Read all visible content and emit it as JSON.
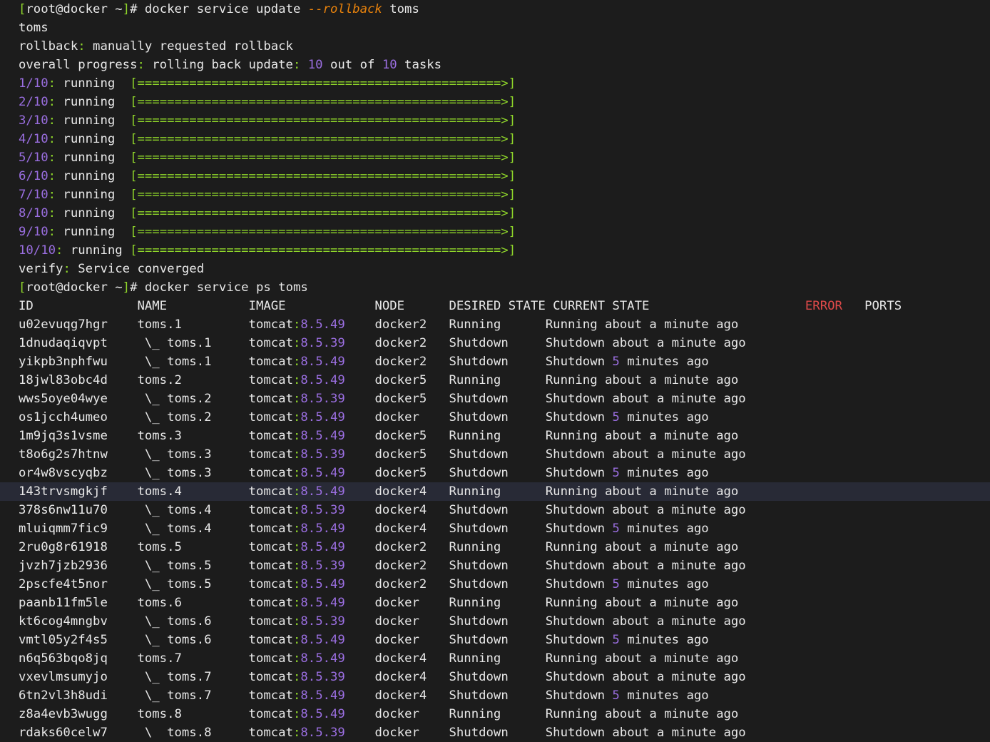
{
  "terminal": {
    "background_color": "#1c1c1c",
    "foreground_color": "#e8e8e8",
    "highlight_color": "#282a36",
    "accent_colors": {
      "green": "#8fd62a",
      "purple": "#9a6ee0",
      "orange": "#e8820c",
      "red": "#e04a4a"
    },
    "prompt": {
      "open_bracket": "[",
      "user_host_path": "root@docker ~",
      "close_bracket": "]",
      "sigil": "# "
    },
    "commands": {
      "first": {
        "program": "docker service update ",
        "flag": "--rollback",
        "argument": " toms"
      },
      "second": {
        "program": "docker service ps toms"
      }
    },
    "update_output": {
      "service_name": "toms",
      "rollback_label": "rollback",
      "rollback_message": " manually requested rollback",
      "overall_label": "overall progress",
      "overall_message_prefix": " rolling back update",
      "overall_count_current": "10",
      "overall_count_mid": " out of ",
      "overall_count_total": "10",
      "overall_count_suffix": " tasks",
      "verify_label": "verify",
      "verify_message": " Service converged",
      "status_word": "running",
      "bar_open": "[",
      "bar_fill": "=================================================>",
      "bar_close": "]",
      "tasks": [
        {
          "index": "1/10",
          "status": "running"
        },
        {
          "index": "2/10",
          "status": "running"
        },
        {
          "index": "3/10",
          "status": "running"
        },
        {
          "index": "4/10",
          "status": "running"
        },
        {
          "index": "5/10",
          "status": "running"
        },
        {
          "index": "6/10",
          "status": "running"
        },
        {
          "index": "7/10",
          "status": "running"
        },
        {
          "index": "8/10",
          "status": "running"
        },
        {
          "index": "9/10",
          "status": "running"
        },
        {
          "index": "10/10",
          "status": "running"
        }
      ]
    },
    "ps_table": {
      "headers": {
        "id": "ID",
        "name": "NAME",
        "image": "IMAGE",
        "node": "NODE",
        "desired_state": "DESIRED STATE",
        "current_state": "CURRENT STATE",
        "error": "ERROR",
        "ports": "PORTS"
      },
      "image_repo": "tomcat",
      "rows": [
        {
          "id": "u02evuqg7hgr",
          "name": "toms.1",
          "indent": false,
          "tag": "8.5.49",
          "node": "docker2",
          "desired": "Running",
          "current_state": "Running",
          "current_time": "about a minute ago",
          "time_num": "",
          "error": "",
          "ports": "",
          "highlight": false
        },
        {
          "id": "1dnudaqiqvpt",
          "name": "\\_ toms.1",
          "indent": true,
          "tag": "8.5.39",
          "node": "docker2",
          "desired": "Shutdown",
          "current_state": "Shutdown",
          "current_time": "about a minute ago",
          "time_num": "",
          "error": "",
          "ports": "",
          "highlight": false
        },
        {
          "id": "yikpb3nphfwu",
          "name": "\\_ toms.1",
          "indent": true,
          "tag": "8.5.49",
          "node": "docker2",
          "desired": "Shutdown",
          "current_state": "Shutdown",
          "current_time": "minutes ago",
          "time_num": "5",
          "error": "",
          "ports": "",
          "highlight": false
        },
        {
          "id": "18jwl83obc4d",
          "name": "toms.2",
          "indent": false,
          "tag": "8.5.49",
          "node": "docker5",
          "desired": "Running",
          "current_state": "Running",
          "current_time": "about a minute ago",
          "time_num": "",
          "error": "",
          "ports": "",
          "highlight": false
        },
        {
          "id": "wws5oye04wye",
          "name": "\\_ toms.2",
          "indent": true,
          "tag": "8.5.39",
          "node": "docker5",
          "desired": "Shutdown",
          "current_state": "Shutdown",
          "current_time": "about a minute ago",
          "time_num": "",
          "error": "",
          "ports": "",
          "highlight": false
        },
        {
          "id": "os1jcch4umeo",
          "name": "\\_ toms.2",
          "indent": true,
          "tag": "8.5.49",
          "node": "docker",
          "desired": "Shutdown",
          "current_state": "Shutdown",
          "current_time": "minutes ago",
          "time_num": "5",
          "error": "",
          "ports": "",
          "highlight": false
        },
        {
          "id": "1m9jq3s1vsme",
          "name": "toms.3",
          "indent": false,
          "tag": "8.5.49",
          "node": "docker5",
          "desired": "Running",
          "current_state": "Running",
          "current_time": "about a minute ago",
          "time_num": "",
          "error": "",
          "ports": "",
          "highlight": false
        },
        {
          "id": "t8o6g2s7htnw",
          "name": "\\_ toms.3",
          "indent": true,
          "tag": "8.5.39",
          "node": "docker5",
          "desired": "Shutdown",
          "current_state": "Shutdown",
          "current_time": "about a minute ago",
          "time_num": "",
          "error": "",
          "ports": "",
          "highlight": false
        },
        {
          "id": "or4w8vscyqbz",
          "name": "\\_ toms.3",
          "indent": true,
          "tag": "8.5.49",
          "node": "docker5",
          "desired": "Shutdown",
          "current_state": "Shutdown",
          "current_time": "minutes ago",
          "time_num": "5",
          "error": "",
          "ports": "",
          "highlight": false
        },
        {
          "id": "143trvsmgkjf",
          "name": "toms.4",
          "indent": false,
          "tag": "8.5.49",
          "node": "docker4",
          "desired": "Running",
          "current_state": "Running",
          "current_time": "about a minute ago",
          "time_num": "",
          "error": "",
          "ports": "",
          "highlight": true
        },
        {
          "id": "378s6nw11u70",
          "name": "\\_ toms.4",
          "indent": true,
          "tag": "8.5.39",
          "node": "docker4",
          "desired": "Shutdown",
          "current_state": "Shutdown",
          "current_time": "about a minute ago",
          "time_num": "",
          "error": "",
          "ports": "",
          "highlight": false
        },
        {
          "id": "mluiqmm7fic9",
          "name": "\\_ toms.4",
          "indent": true,
          "tag": "8.5.49",
          "node": "docker4",
          "desired": "Shutdown",
          "current_state": "Shutdown",
          "current_time": "minutes ago",
          "time_num": "5",
          "error": "",
          "ports": "",
          "highlight": false
        },
        {
          "id": "2ru0g8r61918",
          "name": "toms.5",
          "indent": false,
          "tag": "8.5.49",
          "node": "docker2",
          "desired": "Running",
          "current_state": "Running",
          "current_time": "about a minute ago",
          "time_num": "",
          "error": "",
          "ports": "",
          "highlight": false
        },
        {
          "id": "jvzh7jzb2936",
          "name": "\\_ toms.5",
          "indent": true,
          "tag": "8.5.39",
          "node": "docker2",
          "desired": "Shutdown",
          "current_state": "Shutdown",
          "current_time": "about a minute ago",
          "time_num": "",
          "error": "",
          "ports": "",
          "highlight": false
        },
        {
          "id": "2pscfe4t5nor",
          "name": "\\_ toms.5",
          "indent": true,
          "tag": "8.5.49",
          "node": "docker2",
          "desired": "Shutdown",
          "current_state": "Shutdown",
          "current_time": "minutes ago",
          "time_num": "5",
          "error": "",
          "ports": "",
          "highlight": false
        },
        {
          "id": "paanb11fm5le",
          "name": "toms.6",
          "indent": false,
          "tag": "8.5.49",
          "node": "docker",
          "desired": "Running",
          "current_state": "Running",
          "current_time": "about a minute ago",
          "time_num": "",
          "error": "",
          "ports": "",
          "highlight": false
        },
        {
          "id": "kt6cog4mngbv",
          "name": "\\_ toms.6",
          "indent": true,
          "tag": "8.5.39",
          "node": "docker",
          "desired": "Shutdown",
          "current_state": "Shutdown",
          "current_time": "about a minute ago",
          "time_num": "",
          "error": "",
          "ports": "",
          "highlight": false
        },
        {
          "id": "vmtl05y2f4s5",
          "name": "\\_ toms.6",
          "indent": true,
          "tag": "8.5.49",
          "node": "docker",
          "desired": "Shutdown",
          "current_state": "Shutdown",
          "current_time": "minutes ago",
          "time_num": "5",
          "error": "",
          "ports": "",
          "highlight": false
        },
        {
          "id": "n6q563bqo8jq",
          "name": "toms.7",
          "indent": false,
          "tag": "8.5.49",
          "node": "docker4",
          "desired": "Running",
          "current_state": "Running",
          "current_time": "about a minute ago",
          "time_num": "",
          "error": "",
          "ports": "",
          "highlight": false
        },
        {
          "id": "vxevlmsumyjo",
          "name": "\\_ toms.7",
          "indent": true,
          "tag": "8.5.39",
          "node": "docker4",
          "desired": "Shutdown",
          "current_state": "Shutdown",
          "current_time": "about a minute ago",
          "time_num": "",
          "error": "",
          "ports": "",
          "highlight": false
        },
        {
          "id": "6tn2vl3h8udi",
          "name": "\\_ toms.7",
          "indent": true,
          "tag": "8.5.49",
          "node": "docker4",
          "desired": "Shutdown",
          "current_state": "Shutdown",
          "current_time": "minutes ago",
          "time_num": "5",
          "error": "",
          "ports": "",
          "highlight": false
        },
        {
          "id": "z8a4evb3wugg",
          "name": "toms.8",
          "indent": false,
          "tag": "8.5.49",
          "node": "docker",
          "desired": "Running",
          "current_state": "Running",
          "current_time": "about a minute ago",
          "time_num": "",
          "error": "",
          "ports": "",
          "highlight": false
        },
        {
          "id": "rdaks60celw7",
          "name": "\\  toms.8",
          "indent": true,
          "tag": "8.5.39",
          "node": "docker",
          "desired": "Shutdown",
          "current_state": "Shutdown",
          "current_time": "about a minute ago",
          "time_num": "",
          "error": "",
          "ports": "",
          "highlight": false
        }
      ]
    }
  }
}
